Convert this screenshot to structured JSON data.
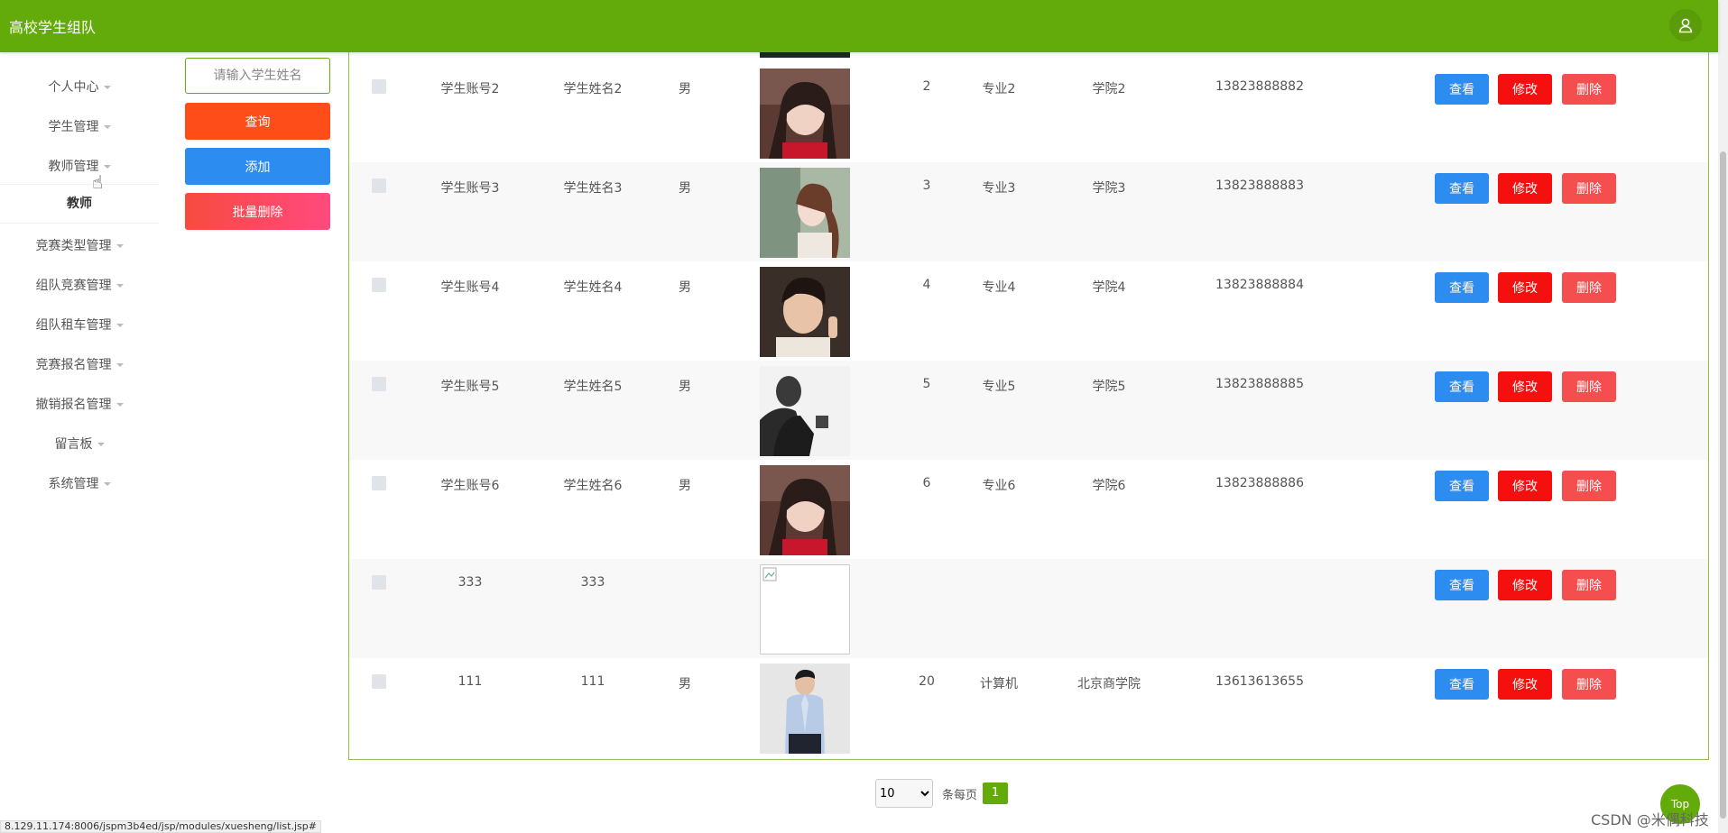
{
  "app": {
    "title": "高校学生组队"
  },
  "sidebar": {
    "items": [
      {
        "label": "个人中心"
      },
      {
        "label": "学生管理"
      },
      {
        "label": "教师管理"
      },
      {
        "label": "竞赛类型管理"
      },
      {
        "label": "组队竞赛管理"
      },
      {
        "label": "组队租车管理"
      },
      {
        "label": "竞赛报名管理"
      },
      {
        "label": "撤销报名管理"
      },
      {
        "label": "留言板"
      },
      {
        "label": "系统管理"
      }
    ],
    "active_sub": "教师"
  },
  "search": {
    "placeholder": "请输入学生姓名"
  },
  "buttons": {
    "query": "查询",
    "add": "添加",
    "batch_delete": "批量删除"
  },
  "row_buttons": {
    "view": "查看",
    "edit": "修改",
    "delete": "删除"
  },
  "table": {
    "rows": [
      {
        "account": "学生账号2",
        "name": "学生姓名2",
        "gender": "男",
        "avatar": "woman-red",
        "age": "2",
        "major": "专业2",
        "college": "学院2",
        "phone": "13823888882"
      },
      {
        "account": "学生账号3",
        "name": "学生姓名3",
        "gender": "男",
        "avatar": "woman-outdoor",
        "age": "3",
        "major": "专业3",
        "college": "学院3",
        "phone": "13823888883"
      },
      {
        "account": "学生账号4",
        "name": "学生姓名4",
        "gender": "男",
        "avatar": "man-peace",
        "age": "4",
        "major": "专业4",
        "college": "学院4",
        "phone": "13823888884"
      },
      {
        "account": "学生账号5",
        "name": "学生姓名5",
        "gender": "男",
        "avatar": "man-dark",
        "age": "5",
        "major": "专业5",
        "college": "学院5",
        "phone": "13823888885"
      },
      {
        "account": "学生账号6",
        "name": "学生姓名6",
        "gender": "男",
        "avatar": "woman-red",
        "age": "6",
        "major": "专业6",
        "college": "学院6",
        "phone": "13823888886"
      },
      {
        "account": "333",
        "name": "333",
        "gender": "",
        "avatar": "broken",
        "age": "",
        "major": "",
        "college": "",
        "phone": ""
      },
      {
        "account": "111",
        "name": "111",
        "gender": "男",
        "avatar": "man-shirt",
        "age": "20",
        "major": "计算机",
        "college": "北京商学院",
        "phone": "13613613655"
      }
    ]
  },
  "pagination": {
    "page_size": "10",
    "per_page_label": "条每页",
    "current_page": "1"
  },
  "status_url": "8.129.11.174:8006/jspm3b4ed/jsp/modules/xuesheng/list.jsp#",
  "top_button": "Top",
  "watermark": "CSDN @米偶科技",
  "colors": {
    "brand": "#63ab0a",
    "view": "#2d8cf0",
    "edit": "#f50f0f",
    "delete": "#f54e4e",
    "query": "#ff4d1a",
    "add": "#2d8cf0"
  }
}
